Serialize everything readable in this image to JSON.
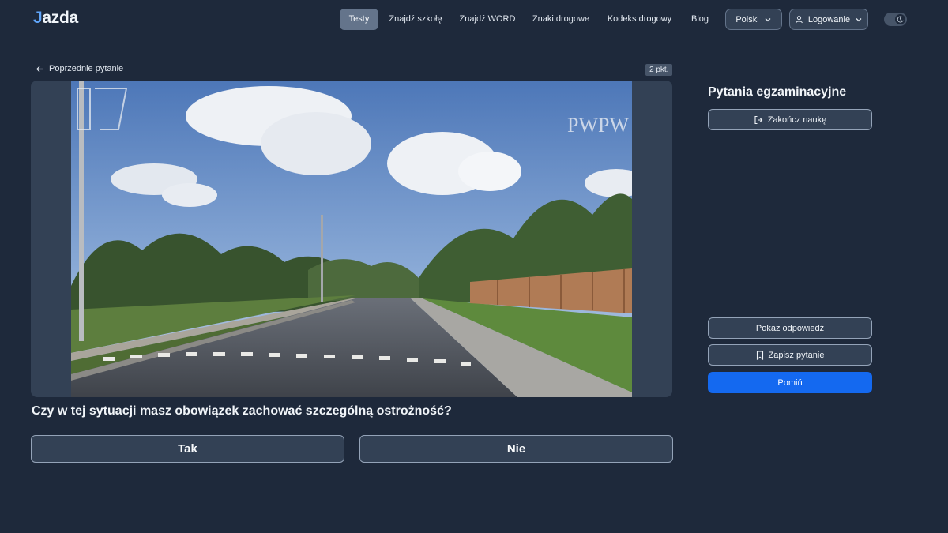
{
  "brand": {
    "logo": "azda",
    "logo_mark": "J"
  },
  "nav": {
    "items": [
      {
        "label": "Testy",
        "active": true
      },
      {
        "label": "Znajdź szkołę"
      },
      {
        "label": "Znajdź WORD"
      },
      {
        "label": "Znaki drogowe"
      },
      {
        "label": "Kodeks drogowy"
      },
      {
        "label": "Blog"
      }
    ],
    "language": "Polski",
    "login": "Logowanie",
    "theme_icon": "moon-icon"
  },
  "question": {
    "back_label": "Poprzednie pytanie",
    "points": "2 pkt.",
    "text": "Czy w tej sytuacji masz obowiązek zachować szczególną ostrożność?",
    "media_watermark": "PWPW",
    "answers": [
      {
        "label": "Tak"
      },
      {
        "label": "Nie"
      }
    ]
  },
  "sidebar": {
    "title": "Pytania egzaminacyjne",
    "end_label": "Zakończ naukę",
    "show_answer": "Pokaż odpowiedź",
    "save_question": "Zapisz pytanie",
    "skip": "Pomiń"
  },
  "colors": {
    "background": "#1e293b",
    "primary": "#1469f0",
    "panel": "#334155"
  }
}
